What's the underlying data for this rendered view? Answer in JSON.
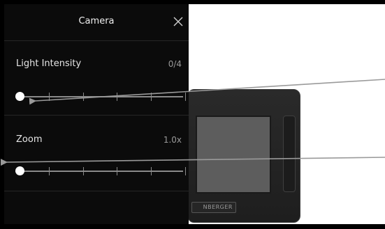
{
  "panel": {
    "title": "Camera",
    "close_icon": "close-icon"
  },
  "settings": [
    {
      "label": "Light Intensity",
      "value": "0/4",
      "slider_fraction": 0.0,
      "ticks": 5
    },
    {
      "label": "Zoom",
      "value": "1.0x",
      "slider_fraction": 0.0,
      "ticks": 5
    }
  ],
  "background": {
    "brand_text": "NBERGER"
  },
  "colors": {
    "panel": "#0b0b0b",
    "text": "#e6e6e6",
    "muted": "#9a9a9a",
    "track": "#8a8a8a",
    "arrow": "#9a9a9a"
  }
}
